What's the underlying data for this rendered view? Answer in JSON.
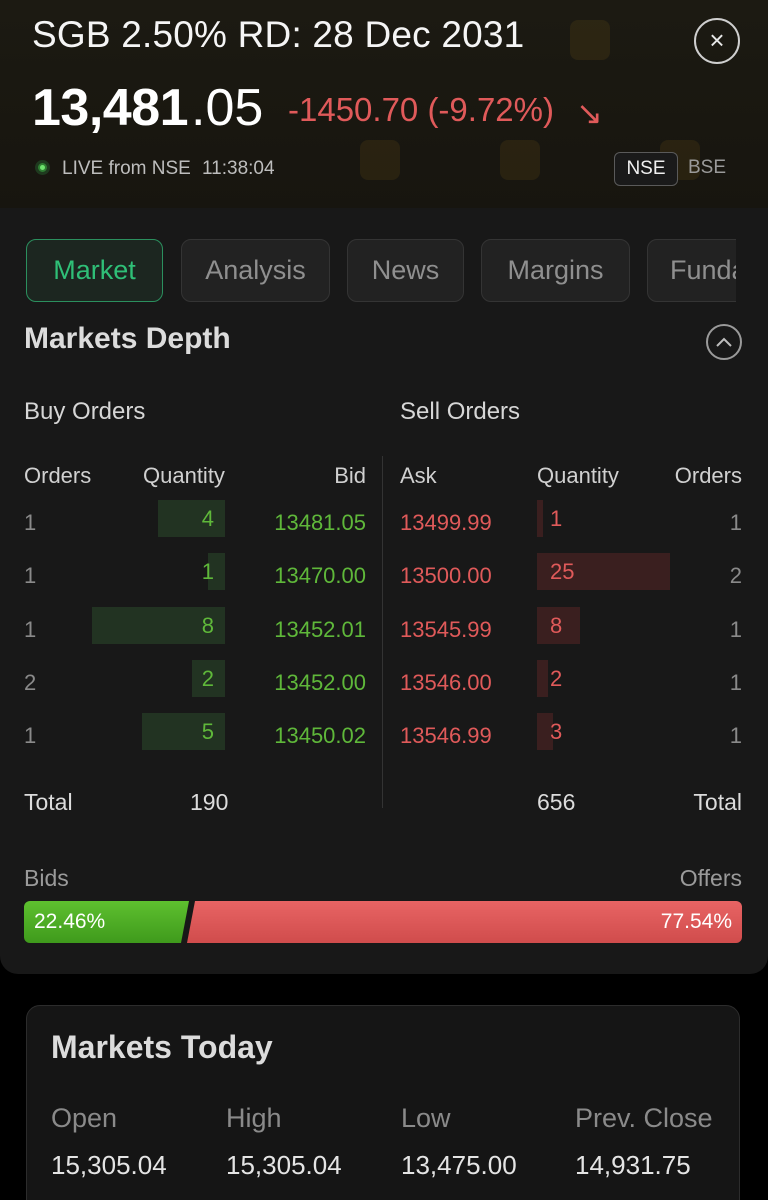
{
  "header": {
    "title": "SGB 2.50% RD: 28 Dec 2031",
    "close_icon": "×",
    "price_integer": "13,481",
    "price_decimal": ".05",
    "change": "-1450.70 (-9.72%)",
    "change_arrow": "↘",
    "live_label": "LIVE from NSE",
    "live_time": "11:38:04",
    "exchanges": [
      "NSE",
      "BSE"
    ],
    "selected_exchange": "NSE"
  },
  "tabs": [
    {
      "label": "Market",
      "active": true
    },
    {
      "label": "Analysis",
      "active": false
    },
    {
      "label": "News",
      "active": false
    },
    {
      "label": "Margins",
      "active": false
    },
    {
      "label": "Funda",
      "active": false
    }
  ],
  "depth": {
    "title": "Markets Depth",
    "collapse_icon": "chevron-up-icon",
    "buy_title": "Buy Orders",
    "sell_title": "Sell Orders",
    "buy_headers": [
      "Orders",
      "Quantity",
      "Bid"
    ],
    "sell_headers": [
      "Ask",
      "Quantity",
      "Orders"
    ],
    "buy_rows": [
      {
        "orders": "1",
        "qty": "4",
        "bid": "13481.05",
        "qty_fraction": 0.5
      },
      {
        "orders": "1",
        "qty": "1",
        "bid": "13470.00",
        "qty_fraction": 0.125
      },
      {
        "orders": "1",
        "qty": "8",
        "bid": "13452.01",
        "qty_fraction": 1.0
      },
      {
        "orders": "2",
        "qty": "2",
        "bid": "13452.00",
        "qty_fraction": 0.25
      },
      {
        "orders": "1",
        "qty": "5",
        "bid": "13450.02",
        "qty_fraction": 0.625
      }
    ],
    "sell_rows": [
      {
        "ask": "13499.99",
        "qty": "1",
        "orders": "1",
        "qty_fraction": 0.04
      },
      {
        "ask": "13500.00",
        "qty": "25",
        "orders": "2",
        "qty_fraction": 1.0
      },
      {
        "ask": "13545.99",
        "qty": "8",
        "orders": "1",
        "qty_fraction": 0.32
      },
      {
        "ask": "13546.00",
        "qty": "2",
        "orders": "1",
        "qty_fraction": 0.08
      },
      {
        "ask": "13546.99",
        "qty": "3",
        "orders": "1",
        "qty_fraction": 0.12
      }
    ],
    "total_label": "Total",
    "total_buy": "190",
    "total_sell": "656",
    "bids_label": "Bids",
    "offers_label": "Offers",
    "bids_pct": "22.46%",
    "offers_pct": "77.54%",
    "bids_fraction": 0.2246
  },
  "today": {
    "title": "Markets Today",
    "stats": [
      {
        "label": "Open",
        "value": "15,305.04"
      },
      {
        "label": "High",
        "value": "15,305.04"
      },
      {
        "label": "Low",
        "value": "13,475.00"
      },
      {
        "label": "Prev. Close",
        "value": "14,931.75"
      }
    ]
  },
  "colors": {
    "up": "#5fb83a",
    "down": "#e05a5a",
    "accent": "#2fbf77"
  }
}
